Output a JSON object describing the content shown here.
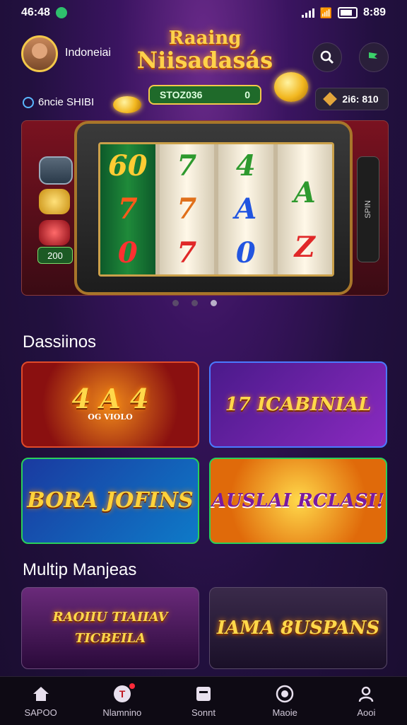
{
  "status": {
    "time": "46:48",
    "right_time": "8:89"
  },
  "header": {
    "username": "Indoneiai",
    "logo_line1": "Raaing",
    "logo_line2": "Niisadasás",
    "balance_value": "STOZ036",
    "balance_badge": "0",
    "uid": "6ncie SHIBI",
    "gems": "2i6: 810"
  },
  "hero": {
    "reels": [
      [
        "60",
        "7",
        "0"
      ],
      [
        "7",
        "7",
        "7"
      ],
      [
        "4",
        "A",
        "0"
      ],
      [
        "",
        "A",
        "Z"
      ]
    ],
    "badge": "200"
  },
  "sections": {
    "casinos_title": "Dassiinos",
    "multi_title": "Multip Manjeas"
  },
  "cards": {
    "c1_text": "4 A 4",
    "c1_sub": "OG VIOLO",
    "c2_text": "17 ICABINIAL",
    "c3_text": "BORA JOFINS",
    "c4_text": "AUSLAI RCLASI!",
    "c5_text": "RAOIIU  TIAIIAV  TICBEILA",
    "c6_text": "IAMA 8USPANS"
  },
  "nav": [
    {
      "label": "SAPOO",
      "icon": "home-icon"
    },
    {
      "label": "Nlamnino",
      "icon": "chip-icon"
    },
    {
      "label": "Sonnt",
      "icon": "box-icon"
    },
    {
      "label": "Maoie",
      "icon": "globe-icon"
    },
    {
      "label": "Aooi",
      "icon": "user-icon"
    }
  ],
  "colors": {
    "accent_gold": "#f3c84a",
    "bg_purple": "#22103f",
    "green": "#1f6a2a"
  }
}
